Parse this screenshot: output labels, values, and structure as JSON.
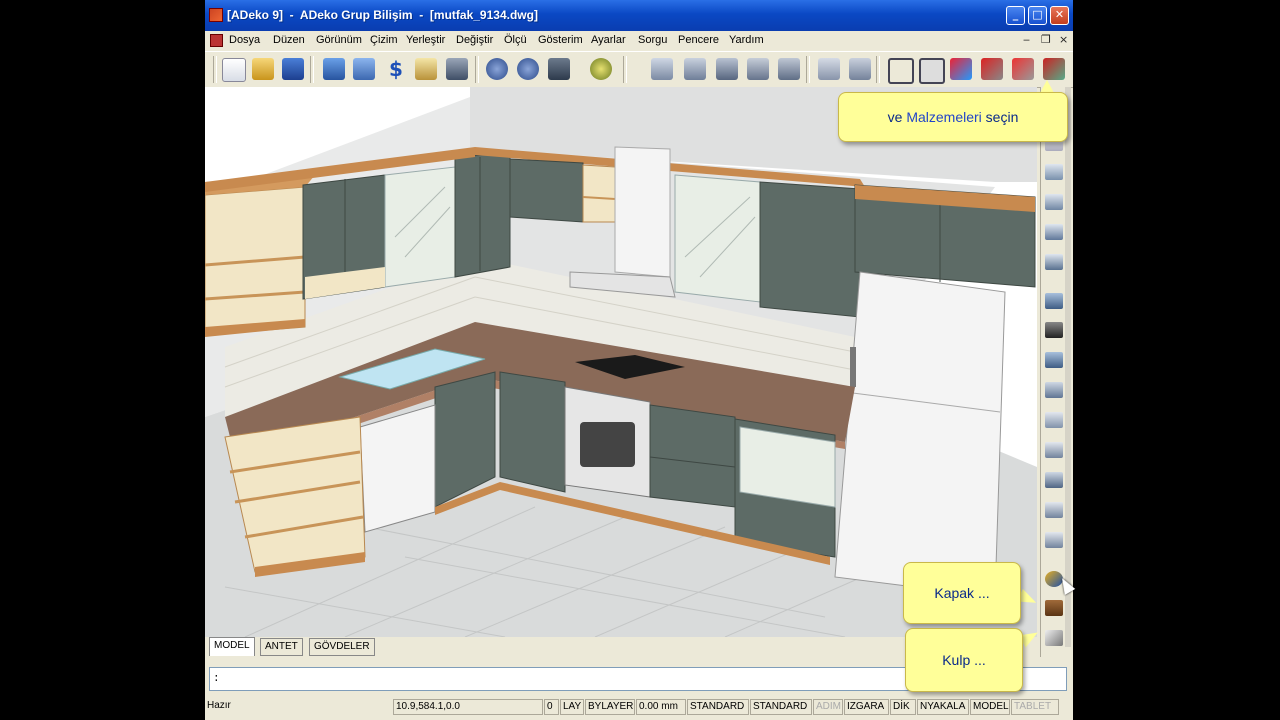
{
  "window": {
    "title": "[ADeko 9]  -  ADeko Grup Bilişim  -  [mutfak_9134.dwg]"
  },
  "title_buttons": {
    "minimize": "_",
    "maximize": "□",
    "close": "✕"
  },
  "menu": [
    "Dosya",
    "Düzen",
    "Görünüm",
    "Çizim",
    "Yerleştir",
    "Değiştir",
    "Ölçü",
    "Gösterim",
    "Ayarlar",
    "Sorgu",
    "Pencere",
    "Yardım"
  ],
  "mdi_controls": {
    "minimize": "‒",
    "restore": "❐",
    "close": "×"
  },
  "toolbar_icons": [
    "new-icon",
    "open-icon",
    "save-icon",
    "print-icon",
    "plot-preview-icon",
    "price-icon",
    "report-icon",
    "render-icon",
    "back-icon",
    "forward-icon",
    "cad-icon",
    "zoom-icon",
    "view-top-icon",
    "view-front-icon",
    "view-left-icon",
    "view-right-icon",
    "view-back-icon",
    "view-iso-icon",
    "wireframe-icon",
    "shade-icon",
    "color-shade-icon",
    "material-icon"
  ],
  "right_toolbar_icons": [
    "wall-cabinet-icon",
    "base-cabinet-icon",
    "corner-cabinet-icon",
    "sink-cabinet-icon",
    "shelf-icon",
    "tall-cabinet-icon",
    "appliance-icon",
    "hood-icon",
    "drawer-icon",
    "panel-icon",
    "plinth-icon",
    "cornice-icon",
    "countertop-icon",
    "accessory-icon",
    "door-material-icon",
    "door-icon",
    "handle-icon"
  ],
  "tabs": {
    "model": "MODEL",
    "antet": "ANTET",
    "govdeler": "GÖVDELER"
  },
  "command_line": ":",
  "status": {
    "ready": "Hazır",
    "coords": "10.9,584.1,0.0",
    "layer_num": "0",
    "lay": "LAY",
    "bylayer": "BYLAYER",
    "thickness": "0.00 mm",
    "style1": "STANDARD",
    "style2": "STANDARD",
    "adim": "ADIM",
    "izgara": "IZGARA",
    "dik": "DİK",
    "nyakala": "NYAKALA",
    "model": "MODEL",
    "tablet": "TABLET"
  },
  "callouts": {
    "malzeme": {
      "prefix": "ve ",
      "highlight": "Malzemeleri",
      "suffix": " seçin"
    },
    "kapak": "Kapak ...",
    "kulp": "Kulp ..."
  },
  "colors": {
    "title_blue": "#0a48c4",
    "tooltip_yellow": "#ffff99",
    "cabinet_gray": "#5d6b66",
    "wood_trim": "#c88a4f",
    "counter_granite": "#8a6a58"
  }
}
